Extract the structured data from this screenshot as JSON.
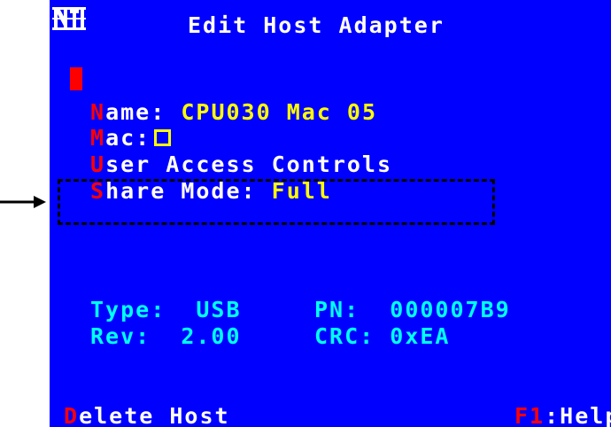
{
  "logo": {
    "text": "NTI"
  },
  "title": "Edit Host Adapter",
  "menu": {
    "name": {
      "hotkey": "N",
      "label": "ame:",
      "value": "CPU030 Mac 05"
    },
    "mac": {
      "hotkey": "M",
      "label": "ac:",
      "checkbox_checked": false
    },
    "user_access": {
      "hotkey": "U",
      "label": "ser Access Controls"
    },
    "share_mode": {
      "hotkey": "S",
      "label": "hare Mode:",
      "value": "Full"
    }
  },
  "info": {
    "type_label": "Type:",
    "type_value": "USB",
    "rev_label": "Rev:",
    "rev_value": "2.00",
    "pn_label": "PN:",
    "pn_value": "000007B9",
    "crc_label": "CRC:",
    "crc_value": "0xEA"
  },
  "footer": {
    "delete_hotkey": "D",
    "delete_label": "elete Host",
    "help_hotkey": "F1",
    "help_label": ":Help"
  },
  "colors": {
    "background": "#0000ff",
    "hotkey": "#ff0000",
    "value": "#ffff00",
    "label": "#ffffff",
    "info": "#00ffff"
  }
}
